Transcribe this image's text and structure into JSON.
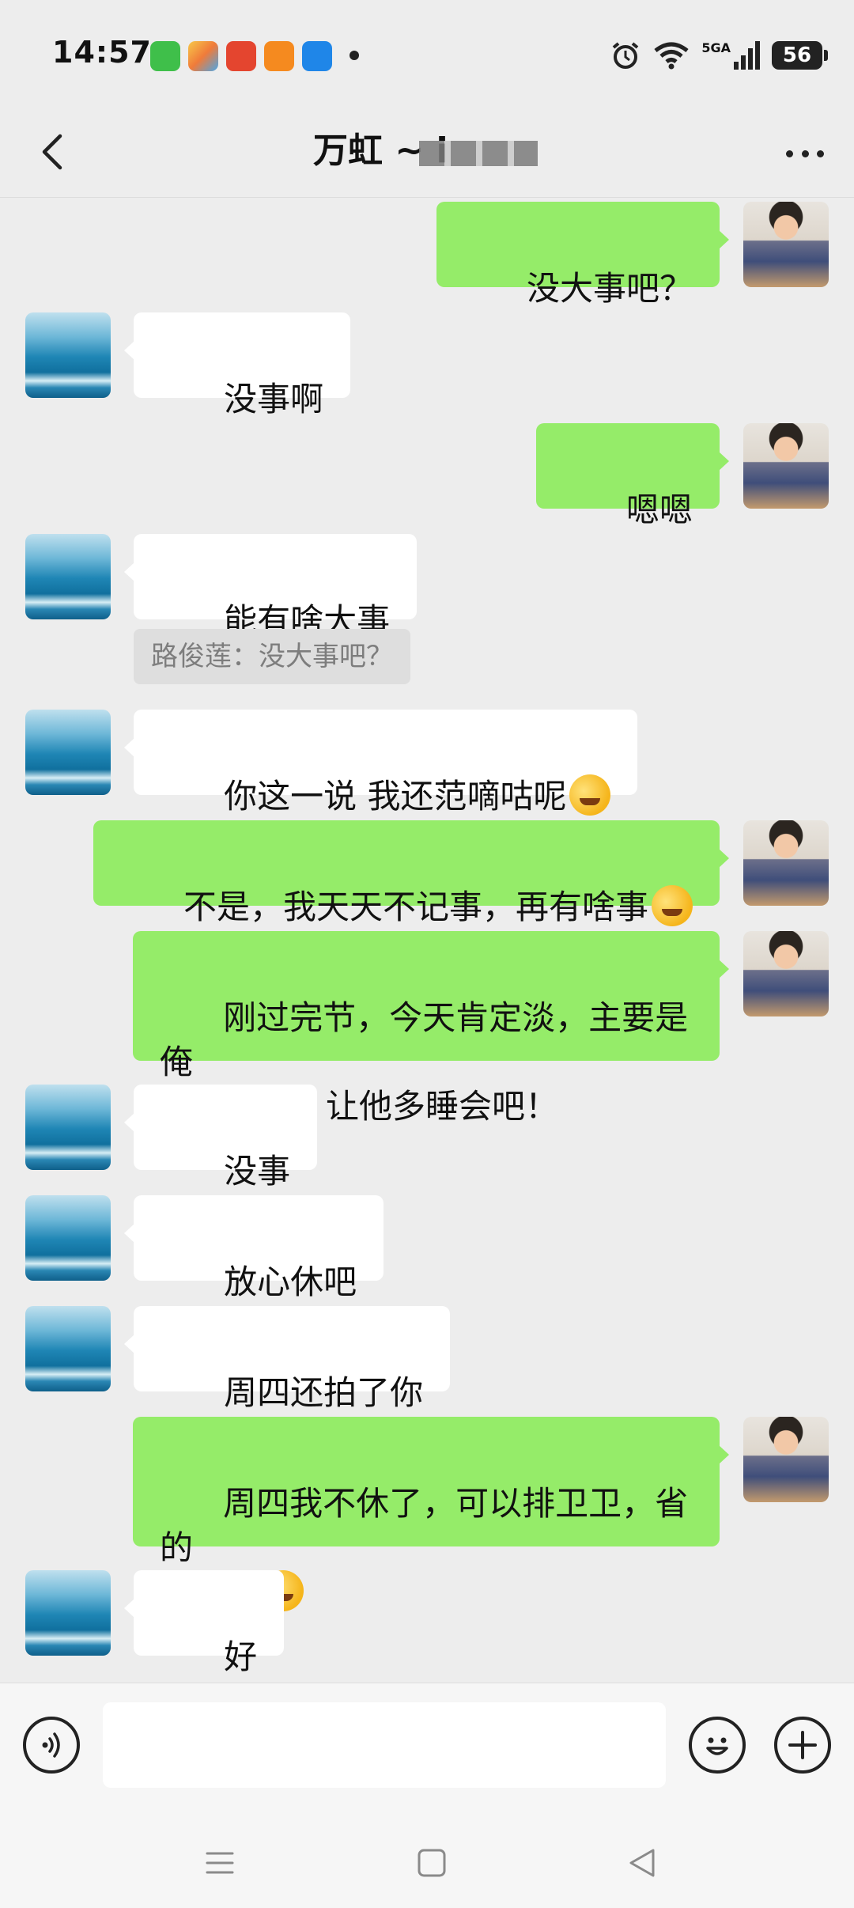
{
  "status_bar": {
    "time": "14:57",
    "signal_tag": "5GA",
    "battery": "56",
    "notification_icons": [
      {
        "name": "messages-app-icon",
        "color": "#3fbf4a"
      },
      {
        "name": "pinwheel-app-icon",
        "color": "#f07b3a"
      },
      {
        "name": "red-bag-app-icon",
        "color": "#e4452f"
      },
      {
        "name": "orange-app-icon",
        "color": "#f58a1f"
      },
      {
        "name": "blue-app-icon",
        "color": "#1f86e8"
      }
    ]
  },
  "header": {
    "title": "万虹 ~ i"
  },
  "messages": [
    {
      "side": "me",
      "text": "没大事吧？"
    },
    {
      "side": "them",
      "text": "没事啊"
    },
    {
      "side": "me",
      "text": "嗯嗯"
    },
    {
      "side": "them",
      "text": "能有啥大事"
    },
    {
      "side": "quote",
      "text": "路俊莲：没大事吧？"
    },
    {
      "side": "them",
      "text": "你这一说 我还范嘀咕呢",
      "emoji": "laugh-cry-emoji"
    },
    {
      "side": "me",
      "text": "不是，我天天不记事，再有啥事",
      "emoji": "laugh-cry-emoji"
    },
    {
      "side": "me",
      "text": "刚过完节，今天肯定淡，主要是俺\n儿不醒了，让他多睡会吧！"
    },
    {
      "side": "them",
      "text": "没事"
    },
    {
      "side": "them",
      "text": "放心休吧"
    },
    {
      "side": "them",
      "text": "周四还拍了你"
    },
    {
      "side": "me",
      "text": "周四我不休了，可以排卫卫，省的\n排不开",
      "emoji": "worried-emoji"
    },
    {
      "side": "them",
      "text": "好"
    }
  ],
  "input_bar": {
    "placeholder": ""
  },
  "colors": {
    "background": "#ededed",
    "my_bubble": "#95ec69",
    "their_bubble": "#ffffff"
  }
}
